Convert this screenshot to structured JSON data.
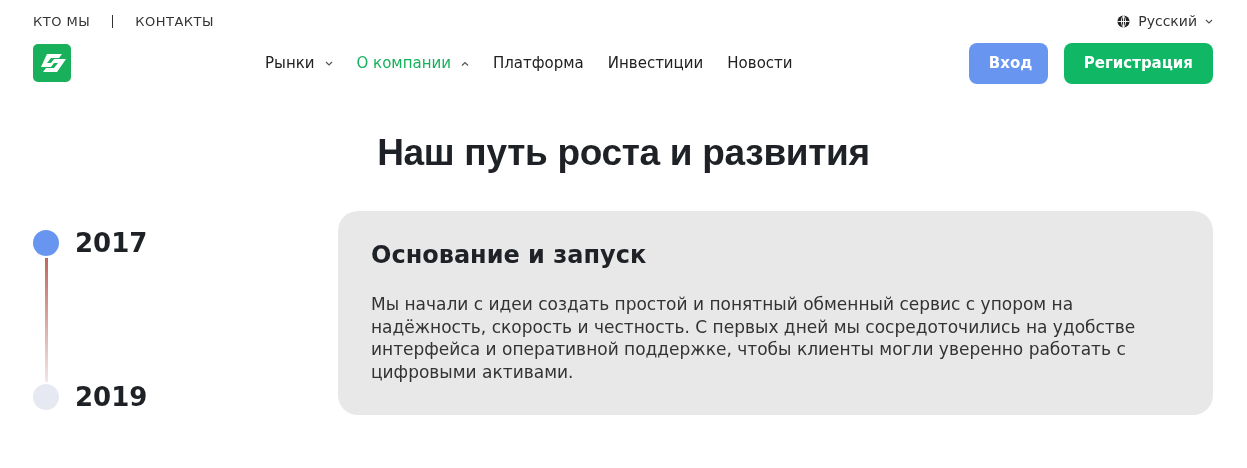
{
  "top_links": [
    "КТО МЫ",
    "КОНТАКТЫ"
  ],
  "language": {
    "label": "Русский"
  },
  "nav": [
    {
      "label": "Рынки",
      "kind": "dropdown",
      "selected": false,
      "expanded": false
    },
    {
      "label": "О компании",
      "kind": "dropdown",
      "selected": true,
      "expanded": true
    },
    {
      "label": "Платформа",
      "kind": "link",
      "selected": false
    },
    {
      "label": "Инвестиции",
      "kind": "link",
      "selected": false
    },
    {
      "label": "Новости",
      "kind": "link",
      "selected": false
    }
  ],
  "buttons": {
    "login": "Вход",
    "register": "Регистрация"
  },
  "heading": "Наш путь роста и развития",
  "timeline": [
    {
      "year": "2017",
      "selected": true
    },
    {
      "year": "2019",
      "selected": false
    }
  ],
  "card": {
    "title": "Основание и запуск",
    "text": "Мы начали с идеи создать простой и понятный обменный сервис с упором на надёжность, скорость и честность. С первых дней мы сосредоточились на удобстве интерфейса и оперативной поддержке, чтобы клиенты могли уверенно работать с цифровыми активами."
  }
}
